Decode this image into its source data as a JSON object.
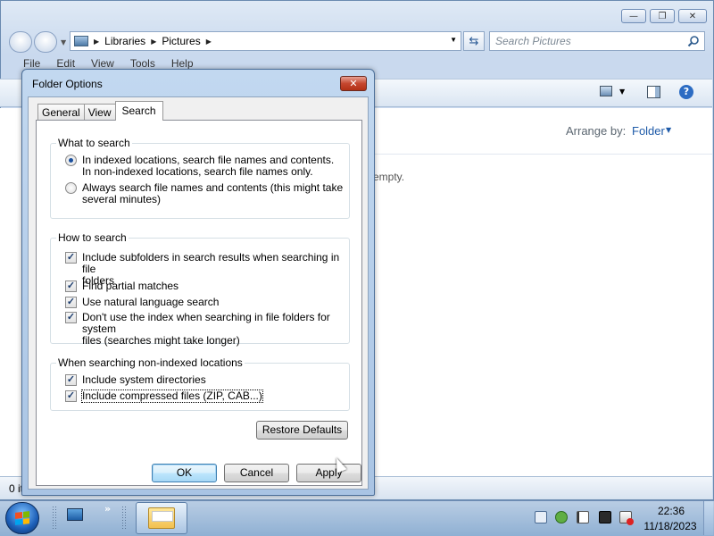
{
  "explorer": {
    "window_controls": {
      "minimize": "—",
      "maximize": "❐",
      "close": "✕"
    },
    "breadcrumb": [
      "Libraries",
      "Pictures"
    ],
    "search_placeholder": "Search Pictures",
    "menu": [
      "File",
      "Edit",
      "View",
      "Tools",
      "Help"
    ],
    "arrange_label": "Arrange by:",
    "arrange_value": "Folder",
    "empty_text": "empty.",
    "status_text": "0 it"
  },
  "dialog": {
    "title": "Folder Options",
    "close_glyph": "✕",
    "tabs": [
      {
        "label": "General",
        "active": false
      },
      {
        "label": "View",
        "active": false
      },
      {
        "label": "Search",
        "active": true
      }
    ],
    "what_to_search": {
      "label": "What to search",
      "options": [
        {
          "text_1": "In indexed locations, search file names and contents.",
          "text_2": "In non-indexed locations, search file names only.",
          "selected": true
        },
        {
          "text_1": "Always search file names and contents (this might take",
          "text_2": "several minutes)",
          "selected": false
        }
      ]
    },
    "how_to_search": {
      "label": "How to search",
      "options": [
        {
          "text_1": "Include subfolders in search results when searching in file",
          "text_2": "folders",
          "checked": true
        },
        {
          "text_1": "Find partial matches",
          "checked": true
        },
        {
          "text_1": "Use natural language search",
          "checked": true
        },
        {
          "text_1": "Don't use the index when searching in file folders for system",
          "text_2": "files (searches might take longer)",
          "checked": true
        }
      ]
    },
    "non_indexed": {
      "label": "When searching non-indexed locations",
      "options": [
        {
          "text_1": "Include system directories",
          "checked": true
        },
        {
          "text_1": "Include compressed files (ZIP, CAB...)",
          "checked": true
        }
      ]
    },
    "restore_defaults": "Restore Defaults",
    "ok": "OK",
    "cancel": "Cancel",
    "apply": "Apply",
    "check_glyph": "✓"
  },
  "taskbar": {
    "chevron": "»",
    "clock_time": "22:36",
    "clock_date": "11/18/2023"
  },
  "colors": {
    "accent_link": "#1e5aa8",
    "dialog_frame": "#a9c4e4",
    "close_button": "#c5472f"
  }
}
